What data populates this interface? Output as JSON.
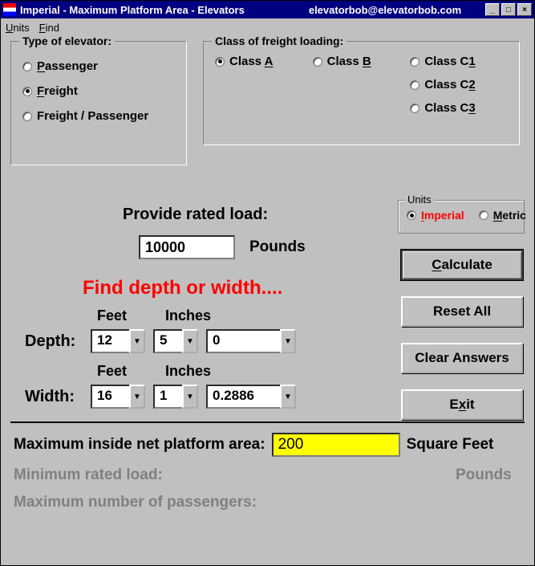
{
  "window": {
    "title": "Imperial - Maximum Platform Area - Elevators",
    "email": "elevatorbob@elevatorbob.com"
  },
  "menu": {
    "units": "Units",
    "find": "Find"
  },
  "type_group": {
    "title": "Type of elevator:",
    "passenger": "Passenger",
    "passenger_u": "P",
    "freight": "Freight",
    "freight_u": "F",
    "freight_pass": "Freight / Passenger",
    "selected": "freight"
  },
  "class_group": {
    "title": "Class of freight loading:",
    "a": "Class A",
    "b": "Class B",
    "c1": "Class C1",
    "c2": "Class C2",
    "c3": "Class C3",
    "selected": "a"
  },
  "load": {
    "label": "Provide rated load:",
    "value": "10000",
    "unit": "Pounds"
  },
  "units_box": {
    "title": "Units",
    "imperial": "Imperial",
    "metric": "Metric",
    "selected": "imperial"
  },
  "buttons": {
    "calculate": "Calculate",
    "reset": "Reset All",
    "clear": "Clear Answers",
    "exit": "Exit"
  },
  "find_text": "Find depth or width....",
  "dims": {
    "feet_h": "Feet",
    "inches_h": "Inches",
    "depth_label": "Depth:",
    "width_label": "Width:",
    "depth_ft": "12",
    "depth_in": "5",
    "depth_frac": "0",
    "width_ft": "16",
    "width_in": "1",
    "width_frac": "0.2886"
  },
  "results": {
    "area_label": "Maximum inside net platform area:",
    "area_value": "200",
    "area_unit": "Square Feet",
    "min_load_label": "Minimum rated load:",
    "min_load_unit": "Pounds",
    "max_pass_label": "Maximum number of passengers:"
  }
}
